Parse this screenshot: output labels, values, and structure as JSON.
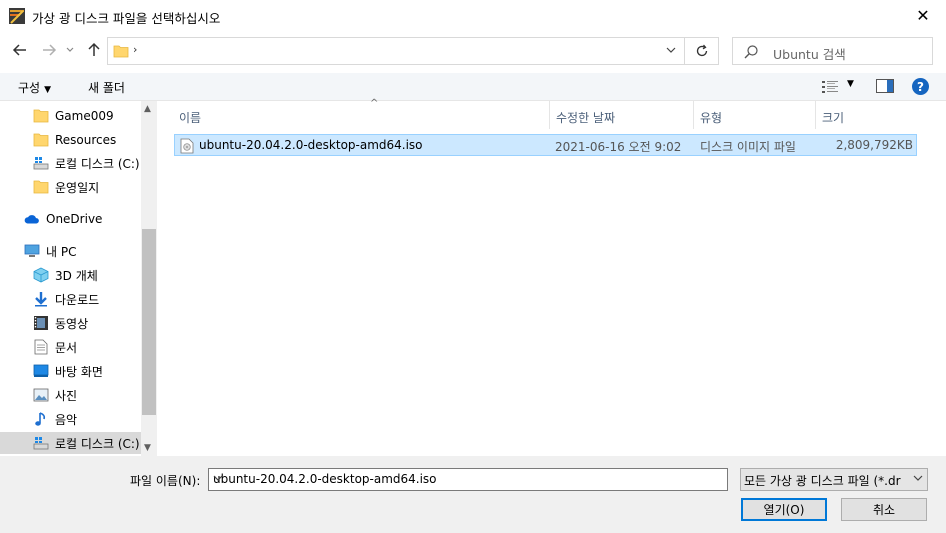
{
  "window": {
    "title": "가상 광 디스크 파일을 선택하십시오",
    "close_glyph": "✕"
  },
  "address": {
    "separator": "›"
  },
  "search": {
    "placeholder": "Ubuntu 검색"
  },
  "toolbar": {
    "organize_label": "구성",
    "new_folder_label": "새 폴더"
  },
  "sidebar": {
    "items": [
      {
        "label": "Game009",
        "icon": "folder-icon"
      },
      {
        "label": "Resources",
        "icon": "folder-icon"
      },
      {
        "label": "로컬 디스크 (C:)",
        "icon": "drive-icon"
      },
      {
        "label": "운영일지",
        "icon": "folder-icon"
      },
      {
        "label": "OneDrive",
        "icon": "cloud-icon"
      },
      {
        "label": "내 PC",
        "icon": "pc-icon"
      },
      {
        "label": "3D 개체",
        "icon": "cube-icon"
      },
      {
        "label": "다운로드",
        "icon": "download-icon"
      },
      {
        "label": "동영상",
        "icon": "video-icon"
      },
      {
        "label": "문서",
        "icon": "document-icon"
      },
      {
        "label": "바탕 화면",
        "icon": "desktop-icon"
      },
      {
        "label": "사진",
        "icon": "pictures-icon"
      },
      {
        "label": "음악",
        "icon": "music-icon"
      },
      {
        "label": "로컬 디스크 (C:)",
        "icon": "drive-icon"
      }
    ]
  },
  "columns": {
    "name": "이름",
    "date": "수정한 날짜",
    "type": "유형",
    "size": "크기"
  },
  "files": [
    {
      "name": "ubuntu-20.04.2.0-desktop-amd64.iso",
      "date": "2021-06-16 오전 9:02",
      "type": "디스크 이미지 파일",
      "size": "2,809,792KB"
    }
  ],
  "footer": {
    "filename_label": "파일 이름(N):",
    "filename_value": "ubuntu-20.04.2.0-desktop-amd64.iso",
    "filter_value": "모든 가상 광 디스크 파일 (*.dr",
    "open_label": "열기(O)",
    "cancel_label": "취소"
  },
  "colors": {
    "selection_bg": "#cce8ff",
    "selection_border": "#99d1ff",
    "accent": "#0078d7",
    "header_text": "#4c607a"
  }
}
